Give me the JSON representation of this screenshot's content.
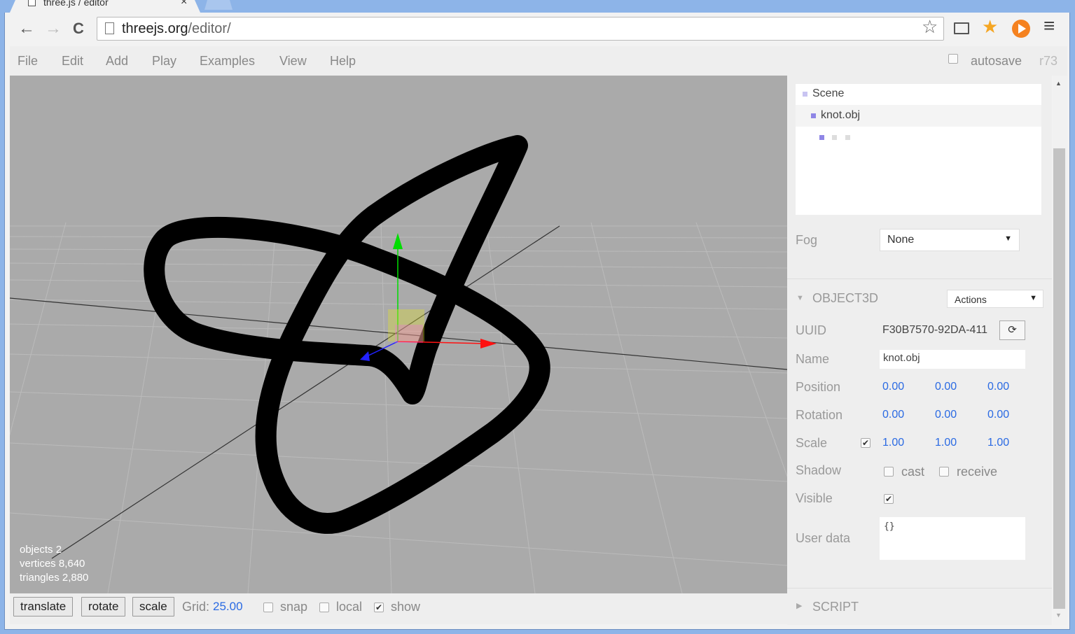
{
  "browser": {
    "tab_title": "three.js / editor",
    "tab_close": "×",
    "url_host": "threejs.org",
    "url_path": "/editor/",
    "back": "←",
    "forward": "→",
    "reload": "C",
    "star": "☆",
    "menu": "≡"
  },
  "menubar": {
    "items": [
      "File",
      "Edit",
      "Add",
      "Play",
      "Examples",
      "View",
      "Help"
    ],
    "autosave_label": "autosave",
    "version": "r73"
  },
  "viewport": {
    "stats": {
      "objects": "objects  2",
      "vertices": "vertices  8,640",
      "triangles": "triangles  2,880"
    }
  },
  "bottombar": {
    "translate": "translate",
    "rotate": "rotate",
    "scale": "scale",
    "grid_label": "Grid:",
    "grid_value": "25.00",
    "snap": "snap",
    "local": "local",
    "show": "show",
    "show_checked": "✔"
  },
  "sidebar": {
    "outliner": {
      "scene": "Scene",
      "object": "knot.obj"
    },
    "fog": {
      "label": "Fog",
      "value": "None"
    },
    "object3d": {
      "header": "OBJECT3D",
      "actions": "Actions",
      "uuid_label": "UUID",
      "uuid_value": "F30B7570-92DA-411",
      "name_label": "Name",
      "name_value": "knot.obj",
      "position_label": "Position",
      "position": [
        "0.00",
        "0.00",
        "0.00"
      ],
      "rotation_label": "Rotation",
      "rotation": [
        "0.00",
        "0.00",
        "0.00"
      ],
      "scale_label": "Scale",
      "scale_lock": "✔",
      "scale": [
        "1.00",
        "1.00",
        "1.00"
      ],
      "shadow_label": "Shadow",
      "cast": "cast",
      "receive": "receive",
      "visible_label": "Visible",
      "visible_checked": "✔",
      "userdata_label": "User data",
      "userdata_value": "{}"
    },
    "script_header": "SCRIPT"
  },
  "icons": {
    "dropdown": "▼",
    "triangle_down": "▼",
    "triangle_right": "▶",
    "refresh": "⟳",
    "scroll_up": "▲",
    "scroll_down": "▼"
  }
}
